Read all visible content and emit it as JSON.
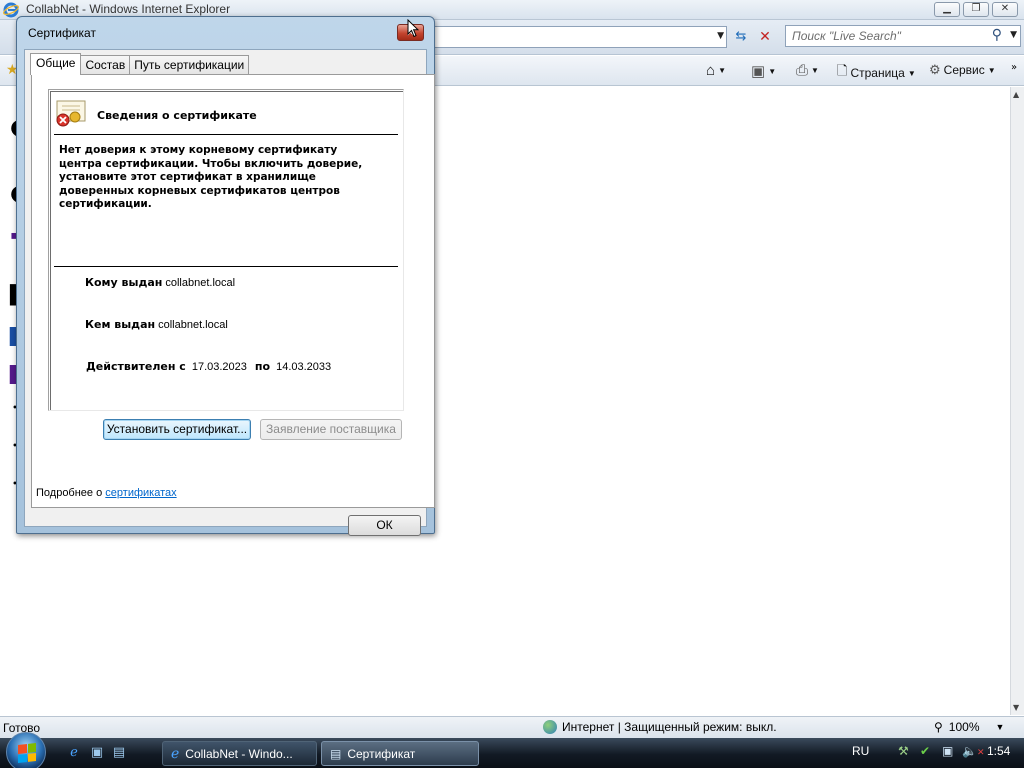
{
  "ie": {
    "title": "CollabNet - Windows Internet Explorer",
    "search_placeholder": "Поиск \"Live Search\"",
    "commands": {
      "page": "Страница",
      "tools": "Сервис"
    },
    "status": {
      "ready": "Готово",
      "zone": "Интернет | Защищенный режим: выкл.",
      "zoom": "100%"
    }
  },
  "dialog": {
    "title": "Сертификат",
    "tabs": [
      {
        "label": "Общие",
        "active": true
      },
      {
        "label": "Состав",
        "active": false
      },
      {
        "label": "Путь сертификации",
        "active": false
      }
    ],
    "heading": "Сведения о сертификате",
    "trust_message": "Нет доверия к этому корневому сертификату\nцентра сертификации. Чтобы включить  доверие,\nустановите этот сертификат в хранилище\nдоверенных корневых сертификатов центров\nсертификации.",
    "issued_to_label": "Кому выдан",
    "issued_to": "collabnet.local",
    "issued_by_label": "Кем выдан",
    "issued_by": "collabnet.local",
    "valid_from_label": "Действителен с",
    "valid_from": "17.03.2023",
    "valid_to_label": "по",
    "valid_to": "14.03.2033",
    "install_button": "Установить сертификат...",
    "issuer_statement_button": "Заявление поставщика",
    "more_prefix": "Подробнее о",
    "more_link": "сертификатах",
    "ok_button": "ОК"
  },
  "taskbar": {
    "items": [
      {
        "label": "CollabNet - Windo...",
        "icon": "ie-icon",
        "active": false
      },
      {
        "label": "Сертификат",
        "icon": "certificate-icon",
        "active": true
      }
    ],
    "language": "RU",
    "clock": "1:54"
  },
  "colors": {
    "link": "#0066cc",
    "close_red": "#c4452f",
    "title_blue": "#bfd6ea"
  }
}
